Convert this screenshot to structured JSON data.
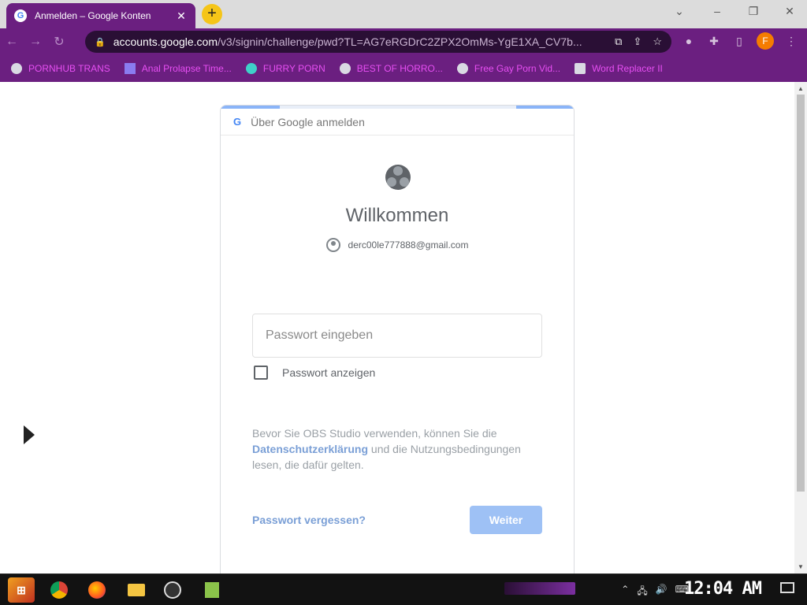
{
  "browser": {
    "tab_title": "Anmelden – Google Konten",
    "tab_favicon": "G",
    "new_tab_label": "+",
    "url_host": "accounts.google.com",
    "url_path": "/v3/signin/challenge/pwd?TL=AG7eRGDrC2ZPX2OmMs-YgE1XA_CV7b...",
    "profile_initial": "F",
    "accent_color": "#6b1f80",
    "bookmarks": [
      {
        "label": "PORNHUB TRANS"
      },
      {
        "label": "Anal Prolapse Time..."
      },
      {
        "label": "FURRY PORN"
      },
      {
        "label": "BEST OF HORRO..."
      },
      {
        "label": "Free Gay Porn Vid..."
      },
      {
        "label": "Word Replacer II"
      }
    ]
  },
  "signin": {
    "header": "Über Google anmelden",
    "header_logo": "G",
    "welcome": "Willkommen",
    "account_email": "derc00le777888@gmail.com",
    "password_placeholder": "Passwort eingeben",
    "show_password_label": "Passwort anzeigen",
    "notice_prefix": "Bevor Sie OBS Studio verwenden, können Sie die ",
    "notice_link": "Datenschutzerklärung",
    "notice_suffix": " und die Nutzungsbedingungen lesen, die dafür gelten.",
    "forgot_password": "Passwort vergessen?",
    "next_button": "Weiter"
  },
  "taskbar": {
    "clock": "12:04 AM"
  }
}
